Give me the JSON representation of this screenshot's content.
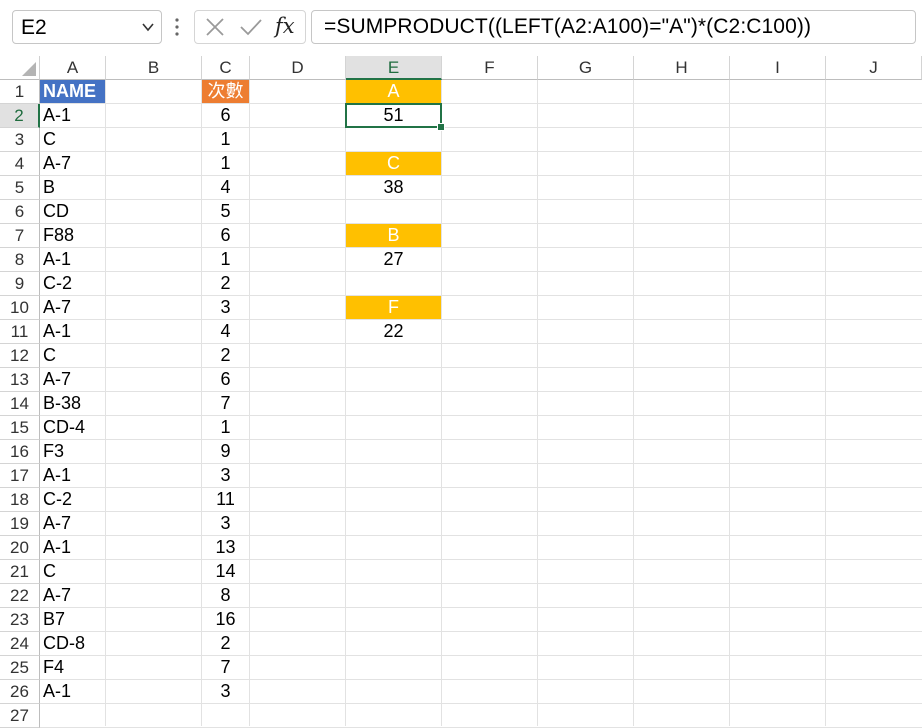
{
  "name_box": {
    "value": "E2"
  },
  "formula_bar": {
    "formula": "=SUMPRODUCT((LEFT(A2:A100)=\"A\")*(C2:C100))",
    "fx_label": "fx"
  },
  "columns": [
    "A",
    "B",
    "C",
    "D",
    "E",
    "F",
    "G",
    "H",
    "I",
    "J"
  ],
  "selected_column": "E",
  "rows": [
    1,
    2,
    3,
    4,
    5,
    6,
    7,
    8,
    9,
    10,
    11,
    12,
    13,
    14,
    15,
    16,
    17,
    18,
    19,
    20,
    21,
    22,
    23,
    24,
    25,
    26,
    27
  ],
  "selected_row": 2,
  "column_a": {
    "header": "NAME",
    "values": [
      "A-1",
      "C",
      "A-7",
      "B",
      "CD",
      "F88",
      "A-1",
      "C-2",
      "A-7",
      "A-1",
      "C",
      "A-7",
      "B-38",
      "CD-4",
      "F3",
      "A-1",
      "C-2",
      "A-7",
      "A-1",
      "C",
      "A-7",
      "B7",
      "CD-8",
      "F4",
      "A-1"
    ]
  },
  "column_c": {
    "header": "次數",
    "values": [
      "6",
      "1",
      "1",
      "4",
      "5",
      "6",
      "1",
      "2",
      "3",
      "4",
      "2",
      "6",
      "7",
      "1",
      "9",
      "3",
      "11",
      "3",
      "13",
      "14",
      "8",
      "16",
      "2",
      "7",
      "3"
    ]
  },
  "summary": [
    {
      "label": "A",
      "value": "51"
    },
    {
      "label": "C",
      "value": "38"
    },
    {
      "label": "B",
      "value": "27"
    },
    {
      "label": "F",
      "value": "22"
    }
  ],
  "colors": {
    "name_header_bg": "#4472c4",
    "count_header_bg": "#ed7d31",
    "label_bg": "#ffc000",
    "selection": "#217346"
  }
}
